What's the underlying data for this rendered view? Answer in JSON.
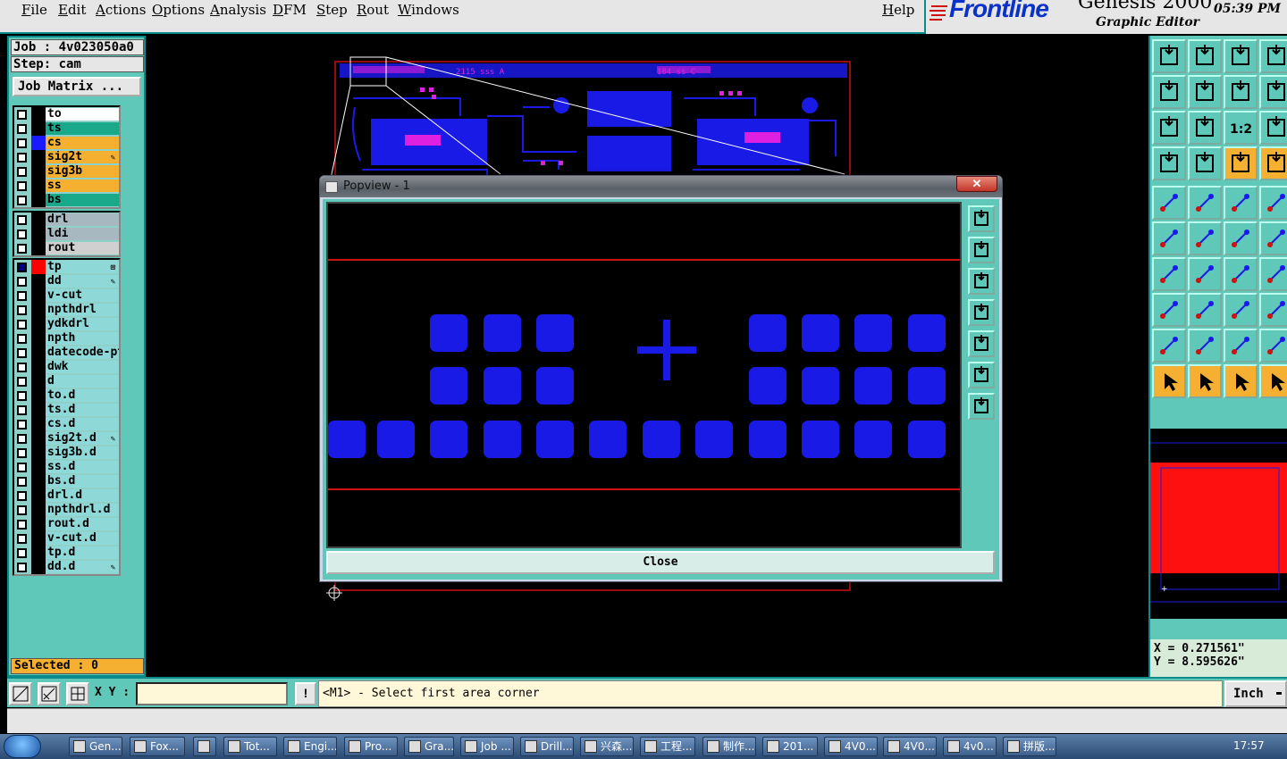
{
  "menu": {
    "items": [
      "File",
      "Edit",
      "Actions",
      "Options",
      "Analysis",
      "DFM",
      "Step",
      "Rout",
      "Windows"
    ],
    "help": "Help"
  },
  "brand": {
    "logo": "Frontline",
    "app": "Genesis 2000",
    "subtitle": "Graphic Editor",
    "clock": "05:39 PM"
  },
  "job": {
    "job_line": "Job : 4v023050a0",
    "step_line": "Step: cam",
    "matrix_button": "Job Matrix ..."
  },
  "layers_board": [
    {
      "name": "to",
      "bg": "#ffffff",
      "color": "#000000"
    },
    {
      "name": "ts",
      "bg": "#1aa88a",
      "color": "#000000"
    },
    {
      "name": "cs",
      "bg": "#f5b032",
      "color": "#1a1aff"
    },
    {
      "name": "sig2t",
      "bg": "#f5b032",
      "color": "#000000",
      "pen": true
    },
    {
      "name": "sig3b",
      "bg": "#f5b032",
      "color": "#000000"
    },
    {
      "name": "ss",
      "bg": "#f5b032",
      "color": "#000000"
    },
    {
      "name": "bs",
      "bg": "#1aa88a",
      "color": "#000000"
    }
  ],
  "layers_drill": [
    {
      "name": "drl",
      "bg": "#a8b8c0",
      "color": "#000000"
    },
    {
      "name": "ldi",
      "bg": "#a8b8c0",
      "color": "#000000"
    },
    {
      "name": "rout",
      "bg": "#d0d0d0",
      "color": "#000000"
    }
  ],
  "layers_misc": [
    {
      "name": "tp",
      "bg": "#8fd8d8",
      "color": "#ff0000",
      "checked": true,
      "mark": "⊞"
    },
    {
      "name": "dd",
      "bg": "#8fd8d8",
      "color": "#000000",
      "pen": true
    },
    {
      "name": "v-cut",
      "bg": "#8fd8d8",
      "color": "#000000"
    },
    {
      "name": "npthdrl",
      "bg": "#8fd8d8",
      "color": "#000000"
    },
    {
      "name": "ydkdrl",
      "bg": "#8fd8d8",
      "color": "#000000"
    },
    {
      "name": "npth",
      "bg": "#8fd8d8",
      "color": "#000000"
    },
    {
      "name": "datecode-pt",
      "bg": "#8fd8d8",
      "color": "#000000"
    },
    {
      "name": "dwk",
      "bg": "#8fd8d8",
      "color": "#000000"
    },
    {
      "name": "d",
      "bg": "#8fd8d8",
      "color": "#000000"
    },
    {
      "name": "to.d",
      "bg": "#8fd8d8",
      "color": "#000000"
    },
    {
      "name": "ts.d",
      "bg": "#8fd8d8",
      "color": "#000000"
    },
    {
      "name": "cs.d",
      "bg": "#8fd8d8",
      "color": "#000000"
    },
    {
      "name": "sig2t.d",
      "bg": "#8fd8d8",
      "color": "#000000",
      "pen": true
    },
    {
      "name": "sig3b.d",
      "bg": "#8fd8d8",
      "color": "#000000"
    },
    {
      "name": "ss.d",
      "bg": "#8fd8d8",
      "color": "#000000"
    },
    {
      "name": "bs.d",
      "bg": "#8fd8d8",
      "color": "#000000"
    },
    {
      "name": "drl.d",
      "bg": "#8fd8d8",
      "color": "#000000"
    },
    {
      "name": "npthdrl.d",
      "bg": "#8fd8d8",
      "color": "#000000"
    },
    {
      "name": "rout.d",
      "bg": "#8fd8d8",
      "color": "#000000"
    },
    {
      "name": "v-cut.d",
      "bg": "#8fd8d8",
      "color": "#000000"
    },
    {
      "name": "tp.d",
      "bg": "#8fd8d8",
      "color": "#000000"
    },
    {
      "name": "dd.d",
      "bg": "#8fd8d8",
      "color": "#000000",
      "pen": true
    }
  ],
  "selected": "Selected : 0",
  "coords": {
    "x": "X = 0.271561\"",
    "y": "Y = 8.595626\""
  },
  "command": {
    "xy_label": "X Y :",
    "xy_value": "",
    "bang": "!",
    "prompt": "<M1> - Select first area corner",
    "units": "Inch"
  },
  "popview": {
    "title": "Popview - 1",
    "close_x": "✕",
    "close_button": "Close"
  },
  "canvas_labels": {
    "board_text_1": "2115 sss A",
    "board_text_2": "184 ss C",
    "button_1_2": "1:2"
  },
  "taskbar": {
    "items": [
      "Gen...",
      "Fox...",
      "",
      "Tot...",
      "Engi...",
      "Pro...",
      "Gra...",
      "Job ...",
      "Drill...",
      "兴森...",
      "工程...",
      "制作...",
      "201...",
      "4V0...",
      "4V0...",
      "4v0...",
      "拼版..."
    ],
    "time": "17:57"
  },
  "colors": {
    "panel": "#60c8b8",
    "pad_blue": "#1a1ae6",
    "trace_red": "#cc1111",
    "magenta": "#e020e0"
  }
}
